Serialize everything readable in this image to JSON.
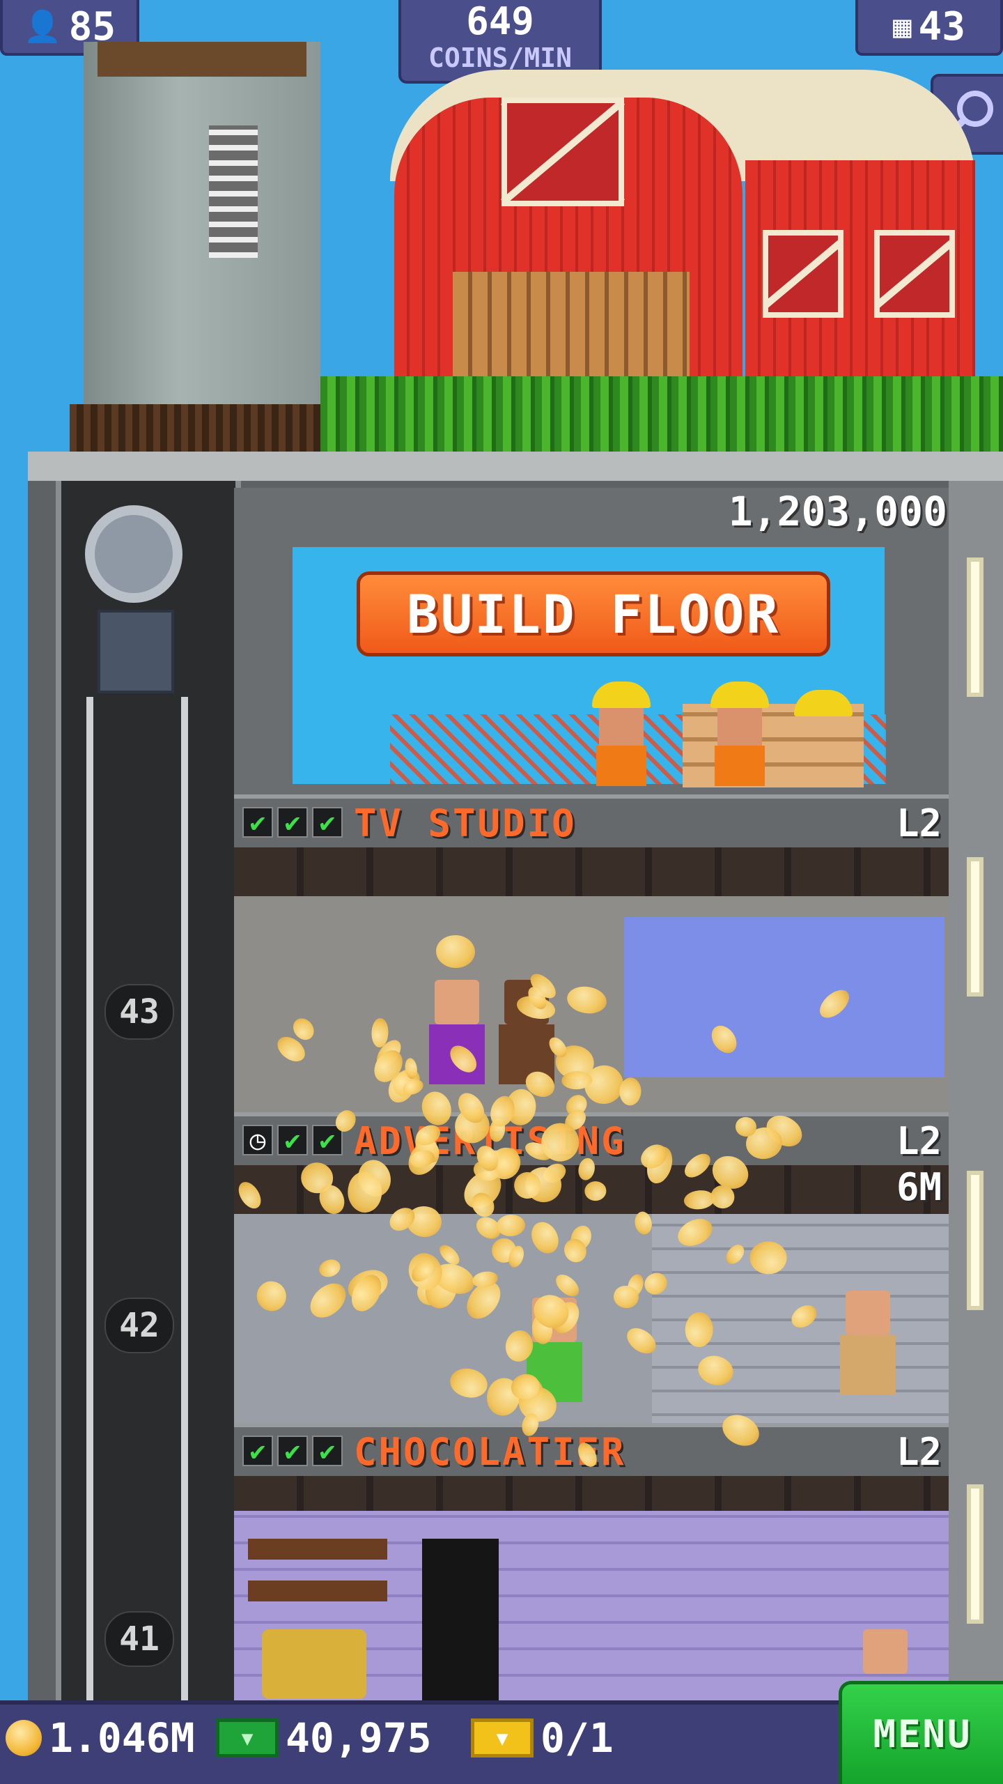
{
  "hud": {
    "population": "85",
    "rate_value": "649",
    "rate_label": "COINS/MIN",
    "floors_count": "43"
  },
  "build": {
    "cost": "1,203,000",
    "button_label": "BUILD FLOOR"
  },
  "floors": [
    {
      "name": "TV STUDIO",
      "level": "L2",
      "checks": [
        "✔",
        "✔",
        "✔"
      ]
    },
    {
      "name": "ADVERTISING",
      "level": "L2",
      "income": "6M",
      "checks": [
        "◷",
        "✔",
        "✔"
      ]
    },
    {
      "name": "CHOCOLATIER",
      "level": "L2",
      "checks": [
        "✔",
        "✔",
        "✔"
      ]
    }
  ],
  "elevator": {
    "markers": [
      "43",
      "42",
      "41"
    ]
  },
  "bottom": {
    "coins": "1.046M",
    "bux": "40,975",
    "tickets": "0/1",
    "menu_label": "MENU"
  },
  "icons": {
    "population": "person-icon",
    "floors": "building-icon",
    "search": "magnifier-icon",
    "coin": "coin-icon",
    "bux": "bux-icon",
    "ticket": "ticket-icon"
  },
  "colors": {
    "hud_bg": "#4a4e8a",
    "build_button": "#f05a1a",
    "floor_name": "#ff6a2a",
    "menu_button": "#14a42c",
    "check": "#3ee04a"
  }
}
